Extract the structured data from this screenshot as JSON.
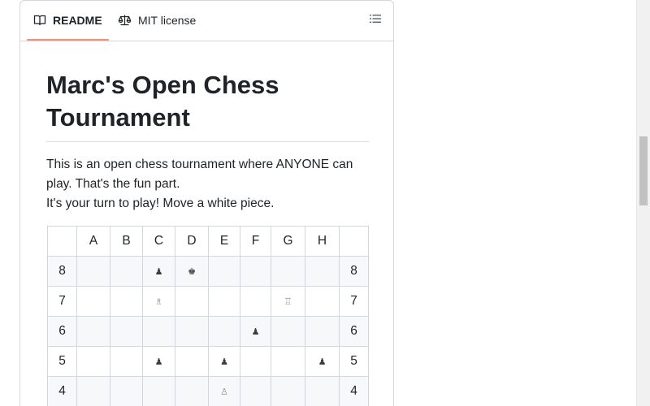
{
  "tabs": [
    {
      "label": "README",
      "icon": "book-icon",
      "selected": true
    },
    {
      "label": "MIT license",
      "icon": "law-scale-icon",
      "selected": false
    }
  ],
  "outline_icon": "list-unordered-icon",
  "readme": {
    "title": "Marc's Open Chess Tournament",
    "line1": "This is an open chess tournament where ANYONE can play. That's the fun part.",
    "line2": "It's your turn to play! Move a white piece."
  },
  "board": {
    "columns": [
      "",
      "A",
      "B",
      "C",
      "D",
      "E",
      "F",
      "G",
      "H",
      ""
    ],
    "rows": [
      {
        "rank": "8",
        "cells": [
          "",
          "",
          "♟",
          "♚",
          "",
          "",
          "",
          ""
        ]
      },
      {
        "rank": "7",
        "cells": [
          "",
          "",
          "♗",
          "",
          "",
          "",
          "♖",
          ""
        ]
      },
      {
        "rank": "6",
        "cells": [
          "",
          "",
          "",
          "",
          "",
          "♟",
          "",
          ""
        ]
      },
      {
        "rank": "5",
        "cells": [
          "",
          "",
          "♟",
          "",
          "♟",
          "",
          "",
          "♟"
        ]
      },
      {
        "rank": "4",
        "cells": [
          "",
          "",
          "",
          "",
          "♙",
          "",
          "",
          ""
        ]
      }
    ]
  },
  "colors": {
    "tab_underline": "#fd8c73",
    "border": "#d0d7de",
    "striped_row": "#f6f8fa",
    "text": "#1f2328"
  }
}
